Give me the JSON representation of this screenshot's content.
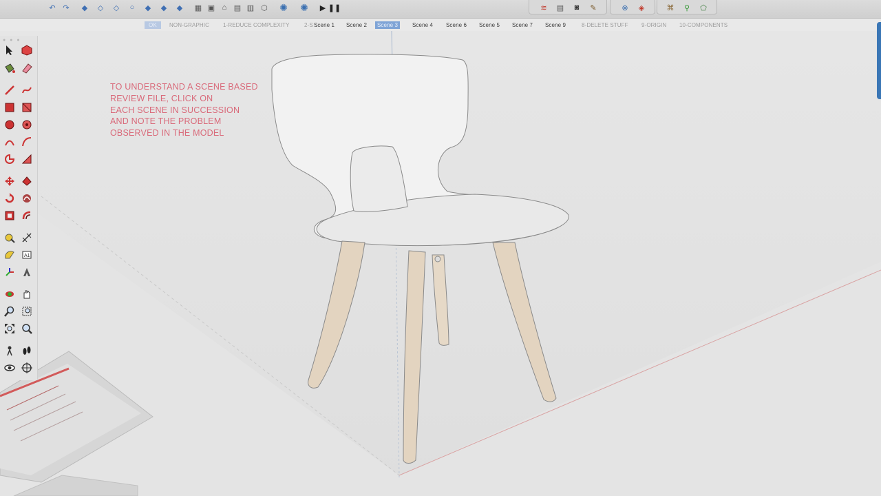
{
  "scene_tabs": {
    "items": [
      {
        "label": "OK",
        "style": "first"
      },
      {
        "label": "NON-GRAPHIC",
        "style": "muted"
      },
      {
        "label": "1-REDUCE COMPLEXITY",
        "style": "muted"
      },
      {
        "label": "2-S",
        "style": "muted"
      },
      {
        "label": "Scene 1",
        "style": "dark"
      },
      {
        "label": "Scene 2",
        "style": "dark"
      },
      {
        "label": "Scene 3",
        "style": "active"
      },
      {
        "label": "Scene 4",
        "style": "dark"
      },
      {
        "label": "Scene 6",
        "style": "dark"
      },
      {
        "label": "Scene 5",
        "style": "dark"
      },
      {
        "label": "Scene 7",
        "style": "dark"
      },
      {
        "label": "Scene 9",
        "style": "dark"
      },
      {
        "label": "8-DELETE STUFF",
        "style": "muted"
      },
      {
        "label": "9-ORIGIN",
        "style": "muted"
      },
      {
        "label": "10-COMPONENTS",
        "style": "muted"
      }
    ]
  },
  "annotation": {
    "lines": [
      "TO UNDERSTAND A SCENE BASED",
      "REVIEW FILE, CLICK ON",
      "EACH SCENE IN SUCCESSION",
      "AND NOTE THE PROBLEM",
      "OBSERVED IN THE MODEL"
    ],
    "color": "#d96a7a"
  },
  "colors": {
    "accent": "#3a76b5",
    "active_tab": "#7fa4d6",
    "chair_shell": "#f2f2f2",
    "chair_legs": "#e3d4c0",
    "red_axis": "#d49a9a",
    "green_axis": "#9fc59f"
  },
  "toolbar": {
    "icons": [
      "undo-icon",
      "redo-icon",
      "views-iso-icon",
      "views-top-icon",
      "views-front-icon",
      "views-right-icon",
      "views-back-icon",
      "views-left-icon",
      "views-bottom-icon",
      "xray-icon",
      "wireframe-icon",
      "hidden-line-icon",
      "shaded-icon",
      "shaded-textures-icon",
      "monochrome-icon",
      "warehouse-icon",
      "extension-icon",
      "play-icon",
      "pause-icon"
    ]
  }
}
